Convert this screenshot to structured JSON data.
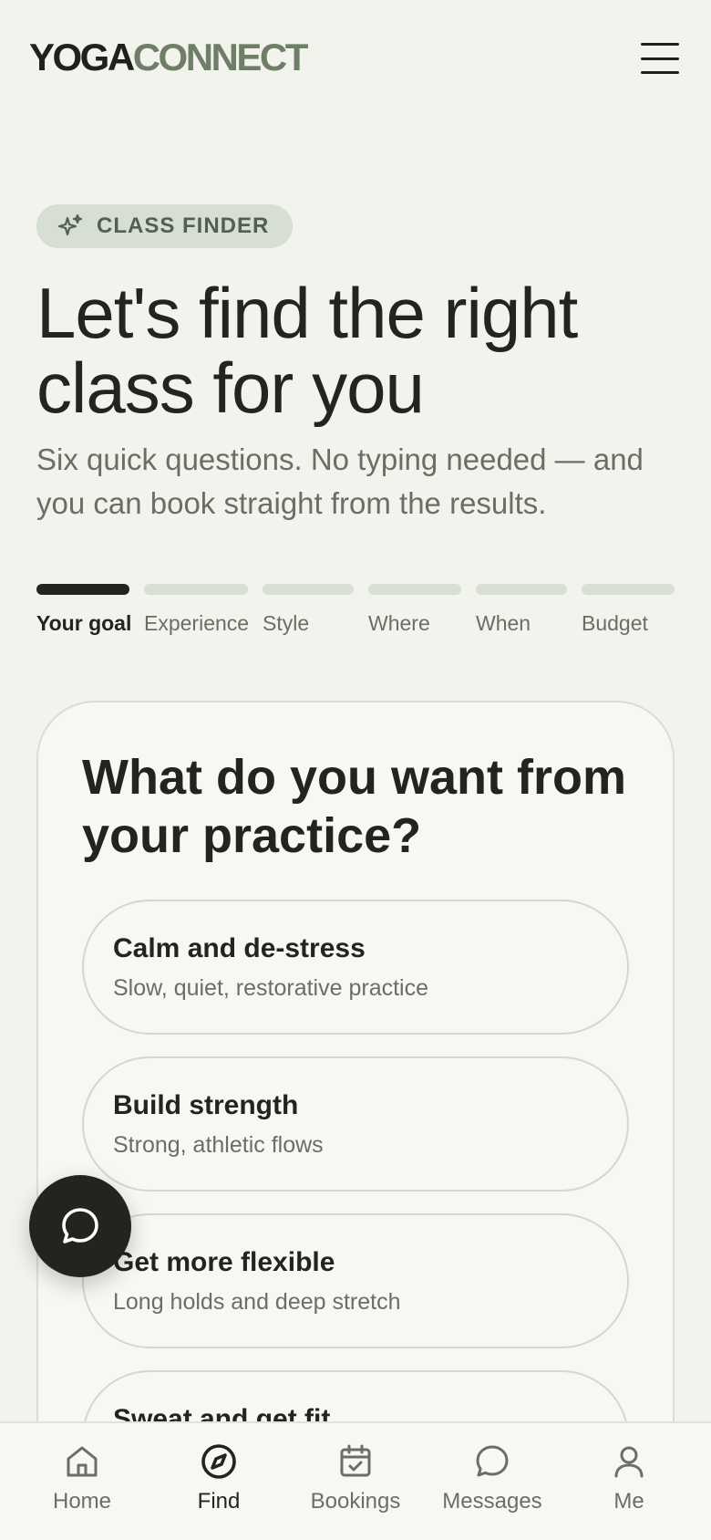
{
  "brand": {
    "part1": "YOGA",
    "part2": "CONNECT"
  },
  "badge": {
    "icon": "sparkles-icon",
    "label": "CLASS FINDER"
  },
  "hero": {
    "title": "Let's find the right class for you",
    "subtitle": "Six quick questions. No typing needed — and you can book straight from the results."
  },
  "steps": [
    {
      "label": "Your goal",
      "active": true
    },
    {
      "label": "Experience",
      "active": false
    },
    {
      "label": "Style",
      "active": false
    },
    {
      "label": "Where",
      "active": false
    },
    {
      "label": "When",
      "active": false
    },
    {
      "label": "Budget",
      "active": false
    }
  ],
  "question": {
    "title": "What do you want from your practice?",
    "options": [
      {
        "title": "Calm and de-stress",
        "subtitle": "Slow, quiet, restorative practice"
      },
      {
        "title": "Build strength",
        "subtitle": "Strong, athletic flows"
      },
      {
        "title": "Get more flexible",
        "subtitle": "Long holds and deep stretch"
      },
      {
        "title": "Sweat and get fit",
        "subtitle": ""
      }
    ]
  },
  "fab": {
    "icon": "chat-bubble-icon"
  },
  "nav": [
    {
      "label": "Home",
      "icon": "home-icon",
      "active": false
    },
    {
      "label": "Find",
      "icon": "compass-icon",
      "active": true
    },
    {
      "label": "Bookings",
      "icon": "calendar-icon",
      "active": false
    },
    {
      "label": "Messages",
      "icon": "message-icon",
      "active": false
    },
    {
      "label": "Me",
      "icon": "user-icon",
      "active": false
    }
  ],
  "colors": {
    "background": "#f3f3ee",
    "accent_green": "#6f7f67",
    "badge_bg": "#d7ded3",
    "dark": "#22241f"
  }
}
